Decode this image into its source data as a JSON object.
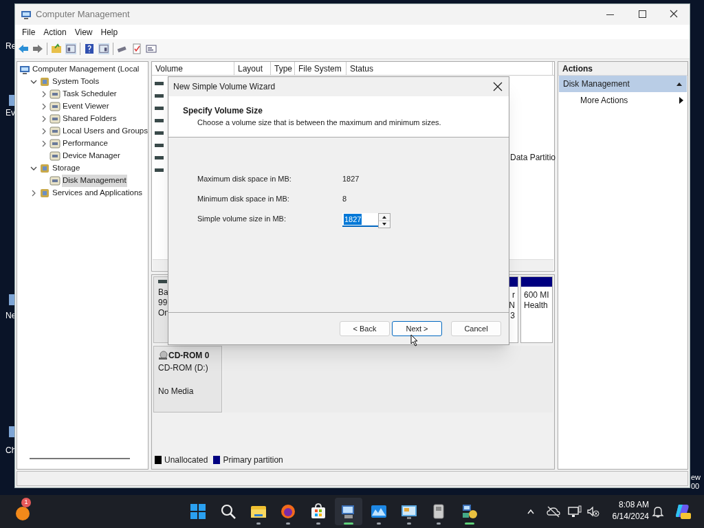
{
  "desktop": {
    "left_edge_labels": [
      "Re",
      "Ev",
      "Ne",
      "Ch"
    ],
    "right_edge_labels": [
      "ew",
      "00"
    ]
  },
  "window": {
    "title": "Computer Management",
    "menu": [
      "File",
      "Action",
      "View",
      "Help"
    ],
    "tree": [
      {
        "label": "Computer Management (Local",
        "selected": false,
        "children": [
          {
            "label": "System Tools",
            "expanded": true,
            "selected": false,
            "children": [
              {
                "label": "Task Scheduler",
                "expanded": false,
                "selected": false
              },
              {
                "label": "Event Viewer",
                "expanded": false,
                "selected": false
              },
              {
                "label": "Shared Folders",
                "expanded": false,
                "selected": false
              },
              {
                "label": "Local Users and Groups",
                "expanded": false,
                "selected": false
              },
              {
                "label": "Performance",
                "expanded": false,
                "selected": false
              },
              {
                "label": "Device Manager",
                "selected": false
              }
            ]
          },
          {
            "label": "Storage",
            "expanded": true,
            "selected": false,
            "children": [
              {
                "label": "Disk Management",
                "selected": true
              }
            ]
          },
          {
            "label": "Services and Applications",
            "expanded": false,
            "selected": false
          }
        ]
      }
    ],
    "volume_list": {
      "columns": [
        "Volume",
        "Layout",
        "Type",
        "File System",
        "Status"
      ],
      "rows": [
        {
          "kind": "volume"
        },
        {
          "kind": "volume"
        },
        {
          "kind": "volume"
        },
        {
          "kind": "volume"
        },
        {
          "kind": "volume"
        },
        {
          "kind": "volume"
        },
        {
          "kind": "volume",
          "status": "Data Partitio"
        },
        {
          "kind": "volume"
        }
      ]
    },
    "disks": [
      {
        "kind": "disk",
        "lines": [
          "Ba",
          "99",
          "On"
        ],
        "partitions": [
          {
            "lines": [
              "r",
              "N",
              "3"
            ],
            "color": "#000080"
          },
          {
            "lines": [
              "600 MI",
              "Health"
            ],
            "color": "#000080"
          }
        ]
      },
      {
        "kind": "cdrom",
        "name": "CD-ROM 0",
        "lines": [
          "CD-ROM (D:)",
          "No Media"
        ]
      }
    ],
    "legend": [
      {
        "label": "Unallocated",
        "color": "#000000"
      },
      {
        "label": "Primary partition",
        "color": "#000080"
      }
    ],
    "actions": {
      "header": "Actions",
      "section": {
        "label": "Disk Management",
        "expanded": true
      },
      "items": [
        "More Actions"
      ]
    }
  },
  "dialog": {
    "title": "New Simple Volume Wizard",
    "heading": "Specify Volume Size",
    "subheading": "Choose a volume size that is between the maximum and minimum sizes.",
    "rows": [
      {
        "kind": "text",
        "label": "Maximum disk space in MB:",
        "value": "1827"
      },
      {
        "kind": "text",
        "label": "Minimum disk space in MB:",
        "value": "8"
      },
      {
        "kind": "spinner",
        "label": "Simple volume size in MB:",
        "value": "1827",
        "selected": true
      }
    ],
    "buttons": [
      {
        "label": "< Back",
        "focused": false
      },
      {
        "label": "Next >",
        "focused": true
      },
      {
        "label": "Cancel",
        "focused": false
      }
    ]
  },
  "taskbar": {
    "badge": "1",
    "apps": [
      {
        "open": false,
        "active": false
      },
      {
        "open": false,
        "active": false
      },
      {
        "open": true,
        "active": false
      },
      {
        "open": true,
        "active": false
      },
      {
        "open": true,
        "active": false
      },
      {
        "open": true,
        "active": true
      },
      {
        "open": true,
        "active": false
      },
      {
        "open": true,
        "active": false
      },
      {
        "open": true,
        "active": false
      },
      {
        "open": true,
        "active": true
      }
    ],
    "time": "8:08 AM",
    "date": "6/14/2024"
  }
}
